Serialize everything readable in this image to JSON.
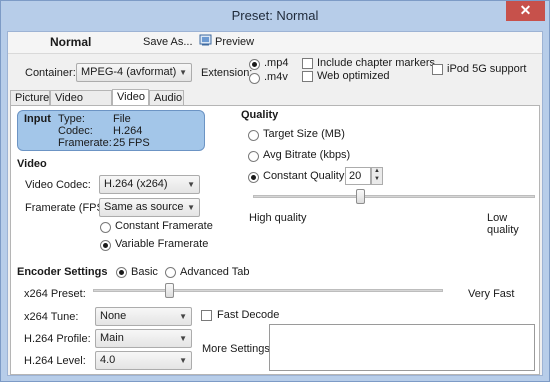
{
  "window": {
    "title": "Preset: Normal",
    "close_glyph": "✕"
  },
  "toolbar": {
    "preset_name": "Normal",
    "save_as_label": "Save As...",
    "preview_label": "Preview",
    "preview_icon": "preview-icon"
  },
  "output": {
    "container_label": "Container:",
    "container_value": "MPEG-4 (avformat)",
    "extension_label": "Extension:",
    "ext_options": [
      ".mp4",
      ".m4v"
    ],
    "ext_selected": ".mp4",
    "include_chapter_label": "Include chapter markers",
    "web_optimized_label": "Web optimized",
    "ipod_label": "iPod 5G support"
  },
  "tabs": [
    "Picture",
    "Video Filters",
    "Video",
    "Audio"
  ],
  "active_tab": "Video",
  "input_info": {
    "heading": "Input",
    "type_label": "Type:",
    "type_value": "File",
    "codec_label": "Codec:",
    "codec_value": "H.264",
    "framerate_label": "Framerate:",
    "framerate_value": "25 FPS"
  },
  "video": {
    "heading": "Video",
    "codec_label": "Video Codec:",
    "codec_value": "H.264 (x264)",
    "framerate_label": "Framerate (FPS):",
    "framerate_value": "Same as source",
    "constant_framerate_label": "Constant Framerate",
    "variable_framerate_label": "Variable Framerate",
    "framerate_mode_selected": "Variable Framerate"
  },
  "quality": {
    "heading": "Quality",
    "target_size_label": "Target Size (MB)",
    "avg_bitrate_label": "Avg Bitrate (kbps)",
    "constant_quality_label": "Constant Quality",
    "mode_selected": "Constant Quality",
    "rf_value": "20",
    "slider_low_label": "High quality",
    "slider_high_label": "Low quality"
  },
  "encoder": {
    "heading": "Encoder Settings",
    "basic_label": "Basic",
    "advanced_label": "Advanced Tab",
    "mode_selected": "Basic",
    "preset_label": "x264 Preset:",
    "preset_value_label": "Very Fast",
    "tune_label": "x264 Tune:",
    "tune_value": "None",
    "fast_decode_label": "Fast Decode",
    "profile_label": "H.264 Profile:",
    "profile_value": "Main",
    "level_label": "H.264 Level:",
    "level_value": "4.0",
    "more_settings_label": "More Settings:"
  }
}
